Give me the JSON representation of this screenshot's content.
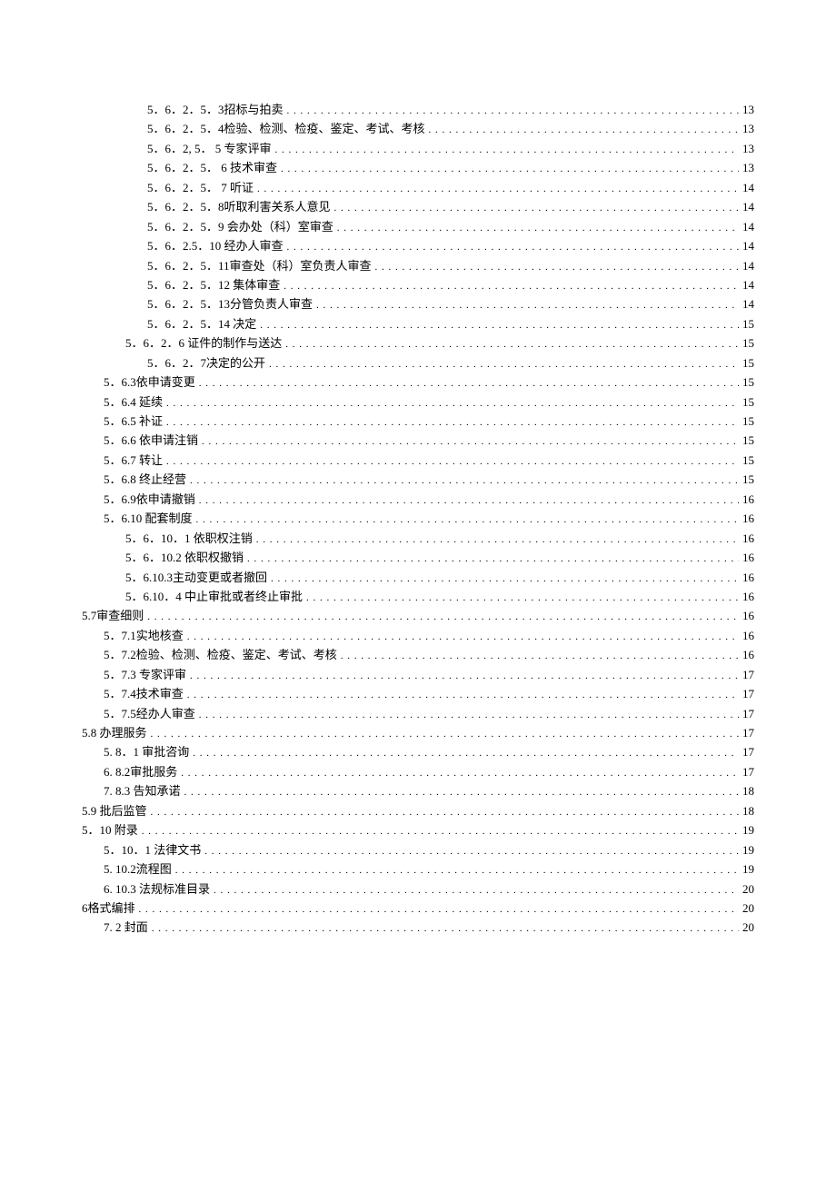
{
  "toc": [
    {
      "indent": 3,
      "label": "5．6．2．5．3招标与拍卖",
      "page": "13"
    },
    {
      "indent": 3,
      "label": "5．6．2．5．4检验、检测、检疫、鉴定、考试、考核",
      "page": "13"
    },
    {
      "indent": 3,
      "label": "5．6．2, 5．  5   专家评审",
      "page": "13"
    },
    {
      "indent": 3,
      "label": "5．6．2．5．  6   技术审查",
      "page": "13"
    },
    {
      "indent": 3,
      "label": "5．6．2．5．  7   听证",
      "page": "14"
    },
    {
      "indent": 3,
      "label": "5．6．2．5．8听取利害关系人意见",
      "page": "14"
    },
    {
      "indent": 3,
      "label": "5．6．2．5．9 会办处（科）室审查",
      "page": "14"
    },
    {
      "indent": 3,
      "label": "5．6．2.5．10 经办人审查",
      "page": "14"
    },
    {
      "indent": 3,
      "label": "5．6．2．5．11审查处（科）室负责人审查",
      "page": "14"
    },
    {
      "indent": 3,
      "label": "5．6．2．5．12 集体审查",
      "page": "14"
    },
    {
      "indent": 3,
      "label": "5．6．2．5．13分管负责人审查",
      "page": "14"
    },
    {
      "indent": 3,
      "label": "5．6．2．5．14 决定",
      "page": "15"
    },
    {
      "indent": 2,
      "label": "5．6．2．6 证件的制作与送达",
      "page": "15"
    },
    {
      "indent": 3,
      "label": "5．6．2．7决定的公开",
      "page": "15"
    },
    {
      "indent": 1,
      "label": "5．6.3依申请变更",
      "page": "15"
    },
    {
      "indent": 1,
      "label": "5．6.4     延续",
      "page": "15"
    },
    {
      "indent": 1,
      "label": "5．6.5     补证",
      "page": "15"
    },
    {
      "indent": 1,
      "label": "5．6.6     依申请注销",
      "page": "15"
    },
    {
      "indent": 1,
      "label": "5．6.7     转让",
      "page": "15"
    },
    {
      "indent": 1,
      "label": "5．6.8     终止经营",
      "page": "15"
    },
    {
      "indent": 1,
      "label": "5．6.9依申请撤销",
      "page": "16"
    },
    {
      "indent": 1,
      "label": "5．6.10 配套制度",
      "page": "16"
    },
    {
      "indent": 2,
      "label": "5．6．10．1 依职权注销",
      "page": "16"
    },
    {
      "indent": 2,
      "label": "5．6．10.2 依职权撤销",
      "page": "16"
    },
    {
      "indent": 2,
      "label": "5．6.10.3主动变更或者撤回",
      "page": "16"
    },
    {
      "indent": 2,
      "label": "5．6.10．4 中止审批或者终止审批",
      "page": "16"
    },
    {
      "indent": 0,
      "label": "5.7审查细则",
      "page": "16"
    },
    {
      "indent": 1,
      "label": "5．7.1实地核查",
      "page": "16"
    },
    {
      "indent": 1,
      "label": "5．7.2检验、检测、检疫、鉴定、考试、考核",
      "page": "16"
    },
    {
      "indent": 1,
      "label": "5．7.3 专家评审",
      "page": "17"
    },
    {
      "indent": 1,
      "label": "5．7.4技术审查",
      "page": "17"
    },
    {
      "indent": 1,
      "label": "5．7.5经办人审查",
      "page": "17"
    },
    {
      "indent": 0,
      "label": "5.8     办理服务",
      "page": "17"
    },
    {
      "indent": 1,
      "label": "5.    8．1 审批咨询",
      "page": "17"
    },
    {
      "indent": 1,
      "label": "6.    8.2审批服务",
      "page": "17"
    },
    {
      "indent": 1,
      "label": "7.    8.3 告知承诺",
      "page": "18"
    },
    {
      "indent": 0,
      "label": "5.9     批后监管",
      "page": "18"
    },
    {
      "indent": 0,
      "label": "5．10 附录",
      "page": "19"
    },
    {
      "indent": 1,
      "label": "5．10．1 法律文书",
      "page": "19"
    },
    {
      "indent": 1,
      "label": "5.    10.2流程图",
      "page": "19"
    },
    {
      "indent": 1,
      "label": "6.    10.3 法规标准目录",
      "page": "20"
    },
    {
      "indent": 0,
      "label": "6格式编排",
      "page": "20"
    },
    {
      "indent": 1,
      "label": "7.   2 封面",
      "page": "20"
    }
  ]
}
